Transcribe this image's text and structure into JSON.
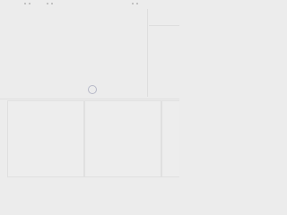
{
  "window": {
    "title": "",
    "status": "loading"
  },
  "toolbar": {
    "groups": [
      {
        "name": "toolbar-dots-left",
        "dots": 2
      },
      {
        "name": "toolbar-dots-center",
        "dots": 2
      },
      {
        "name": "toolbar-dots-right",
        "dots": 2
      }
    ]
  },
  "main": {
    "spinner_label": ""
  },
  "panels": [
    {
      "label": ""
    },
    {
      "label": ""
    },
    {
      "label": ""
    }
  ],
  "colors": {
    "background": "#ececec",
    "divider": "#dedede",
    "spinner": "#b7b9c8",
    "dot": "#b5b5b5"
  }
}
